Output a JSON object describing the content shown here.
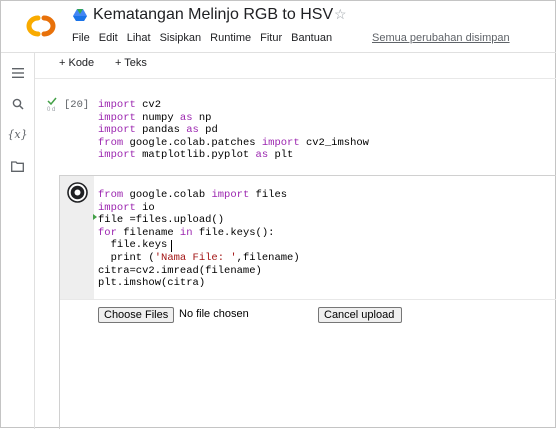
{
  "header": {
    "title": "Kematangan Melinjo RGB to HSV",
    "menu": [
      "File",
      "Edit",
      "Lihat",
      "Sisipkan",
      "Runtime",
      "Fitur",
      "Bantuan"
    ],
    "saved_status": "Semua perubahan disimpan"
  },
  "toolbar": {
    "add_code": "+ Kode",
    "add_text": "+ Teks"
  },
  "sidebar": {
    "items": [
      "table-of-contents-icon",
      "search-icon",
      "variables-icon",
      "files-icon"
    ],
    "variables_label": "{x}"
  },
  "cells": [
    {
      "exec_count": "[20]",
      "status": "completed",
      "time": "0 d",
      "lines": [
        "import cv2",
        "import numpy as np",
        "import pandas as pd",
        "from google.colab.patches import cv2_imshow",
        "import matplotlib.pyplot as plt"
      ]
    },
    {
      "status": "running",
      "lines": [
        "from google.colab import files",
        "import io",
        "file =files.upload()",
        "for filename in file.keys():",
        "  file.keys",
        "  print ('Nama File: ',filename)",
        "citra=cv2.imread(filename)",
        "plt.imshow(citra)"
      ],
      "output": {
        "choose_files": "Choose Files",
        "no_file": "No file chosen",
        "cancel_upload": "Cancel upload"
      }
    }
  ],
  "colors": {
    "keyword": "#9c27b0",
    "string": "#a31515",
    "success": "#43a047",
    "logo_orange": "#f9ab00",
    "logo_dark_orange": "#e8710a",
    "drive_blue": "#4285f4"
  }
}
